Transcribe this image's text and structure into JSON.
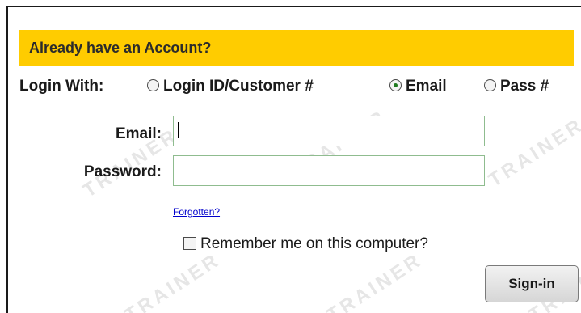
{
  "header": {
    "title": "Already have an Account?"
  },
  "login_with": {
    "label": "Login With:",
    "options": [
      {
        "label": "Login ID/Customer #",
        "checked": false
      },
      {
        "label": "Email",
        "checked": true
      },
      {
        "label": "Pass #",
        "checked": false
      }
    ]
  },
  "email": {
    "label": "Email:",
    "value": ""
  },
  "password": {
    "label": "Password:",
    "value": ""
  },
  "forgot": {
    "label": "Forgotten?"
  },
  "remember": {
    "label": "Remember me on this computer?",
    "checked": false
  },
  "signin": {
    "label": "Sign-in"
  },
  "watermark_text": "TRAINER",
  "colors": {
    "header_bg": "#ffcc00",
    "field_border": "#8fbc8f",
    "link": "#0000cc"
  }
}
